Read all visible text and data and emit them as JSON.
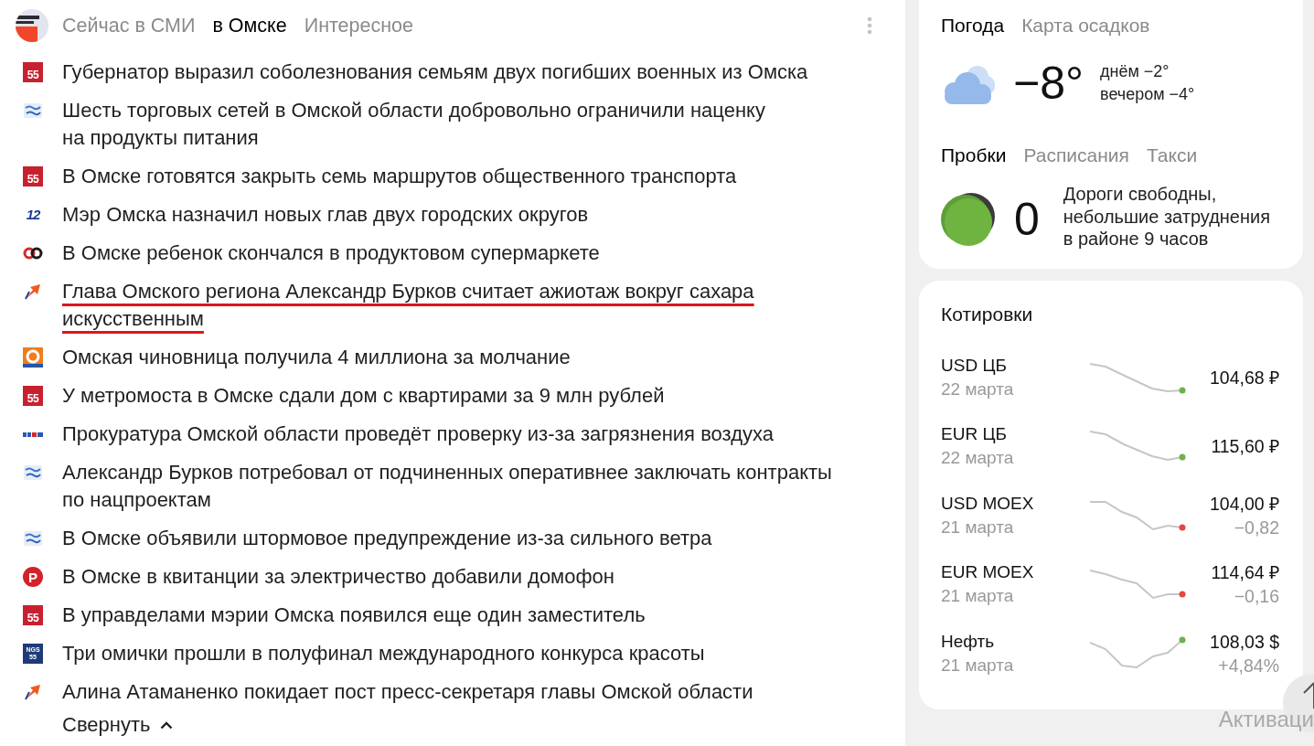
{
  "news_widget": {
    "tabs": [
      {
        "label": "Сейчас в СМИ",
        "selected": false
      },
      {
        "label": "в Омске",
        "selected": true
      },
      {
        "label": "Интересное",
        "selected": false
      }
    ],
    "items": [
      {
        "logo": {
          "kind": "tile",
          "text": "55"
        },
        "headline": "Губернатор выразил соболезнования семьям двух погибших военных из Омска",
        "underlined": false
      },
      {
        "logo": {
          "kind": "badge"
        },
        "headline": "Шесть торговых сетей в Омской области добровольно ограничили наценку\nна продукты питания",
        "underlined": false
      },
      {
        "logo": {
          "kind": "tile",
          "text": "55"
        },
        "headline": "В Омске готовятся закрыть семь маршрутов общественного транспорта",
        "underlined": false
      },
      {
        "logo": {
          "kind": "number",
          "text": "12"
        },
        "headline": "Мэр Омска назначил новых глав двух городских округов",
        "underlined": false
      },
      {
        "logo": {
          "kind": "rings"
        },
        "headline": "В Омске ребенок скончался в продуктовом супермаркете",
        "underlined": false
      },
      {
        "logo": {
          "kind": "arrow"
        },
        "headline": "Глава Омского региона Александр Бурков считает ажиотаж вокруг сахара\nискусственным",
        "underlined": true
      },
      {
        "logo": {
          "kind": "ring-tile"
        },
        "headline": "Омская чиновница получила 4 миллиона за молчание",
        "underlined": false
      },
      {
        "logo": {
          "kind": "tile",
          "text": "55"
        },
        "headline": "У метромоста в Омске сдали дом с квартирами за 9 млн рублей",
        "underlined": false
      },
      {
        "logo": {
          "kind": "wordmark"
        },
        "headline": "Прокуратура Омской области проведёт проверку из-за загрязнения воздуха",
        "underlined": false
      },
      {
        "logo": {
          "kind": "badge"
        },
        "headline": "Александр Бурков потребовал от подчиненных оперативнее заключать контракты\nпо нацпроектам",
        "underlined": false
      },
      {
        "logo": {
          "kind": "badge"
        },
        "headline": "В Омске объявили штормовое предупреждение из-за сильного ветра",
        "underlined": false
      },
      {
        "logo": {
          "kind": "circle-letter",
          "text": "P"
        },
        "headline": "В Омске в квитанции за электричество добавили домофон",
        "underlined": false
      },
      {
        "logo": {
          "kind": "tile",
          "text": "55"
        },
        "headline": "В управделами мэрии Омска появился еще один заместитель",
        "underlined": false
      },
      {
        "logo": {
          "kind": "stack-tile",
          "text": "NGS\n55"
        },
        "headline": "Три омички прошли в полуфинал международного конкурса красоты",
        "underlined": false
      },
      {
        "logo": {
          "kind": "arrow"
        },
        "headline": "Алина Атаманенко покидает пост пресс-секретаря главы Омской области",
        "underlined": false
      }
    ],
    "collapse_link": "Свернуть"
  },
  "weather": {
    "tabs": [
      {
        "label": "Погода",
        "selected": true
      },
      {
        "label": "Карта осадков",
        "selected": false
      }
    ],
    "temperature": "−8°",
    "forecast": [
      "днём −2°",
      "вечером −4°"
    ]
  },
  "traffic": {
    "tabs": [
      {
        "label": "Пробки",
        "selected": true
      },
      {
        "label": "Расписания",
        "selected": false
      },
      {
        "label": "Такси",
        "selected": false
      }
    ],
    "score": "0",
    "description": "Дороги свободны, небольшие затруднения в районе 9 часов"
  },
  "quotes": {
    "title": "Котировки",
    "rows": [
      {
        "name": "USD ЦБ",
        "date": "22 марта",
        "value": "104,68 ₽",
        "color": "#6cb24c"
      },
      {
        "name": "EUR ЦБ",
        "date": "22 марта",
        "value": "115,60 ₽",
        "color": "#6cb24c"
      },
      {
        "name": "USD MOEX",
        "date": "21 марта",
        "value": "104,00 ₽",
        "change": "−0,82",
        "color": "#e5473e"
      },
      {
        "name": "EUR MOEX",
        "date": "21 марта",
        "value": "114,64 ₽",
        "change": "−0,16",
        "color": "#e5473e"
      },
      {
        "name": "Нефть",
        "date": "21 марта",
        "value": "108,03 $",
        "change": "+4,84%",
        "color": "#6cb24c"
      }
    ]
  },
  "activation_notice": "Активаци"
}
